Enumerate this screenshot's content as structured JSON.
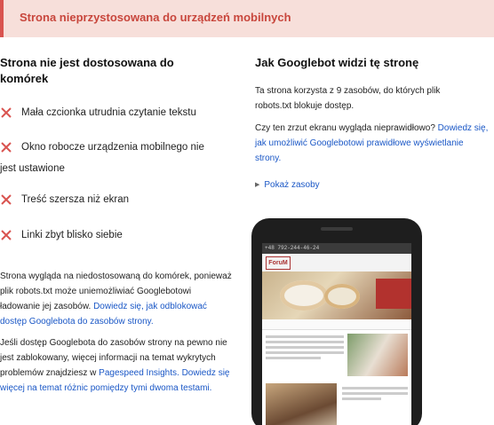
{
  "banner": {
    "title": "Strona nieprzystosowana do urządzeń mobilnych"
  },
  "left": {
    "heading": "Strona nie jest dostosowana do komórek",
    "issues": [
      {
        "icon": "x-icon",
        "label": "Mała czcionka utrudnia czytanie tekstu"
      },
      {
        "icon": "x-icon",
        "label": "Okno robocze urządzenia mobilnego nie",
        "continuation": "jest ustawione"
      },
      {
        "icon": "x-icon",
        "label": "Treść szersza niż ekran"
      },
      {
        "icon": "x-icon",
        "label": "Linki zbyt blisko siebie"
      }
    ],
    "para1": {
      "text": "Strona wygląda na niedostosowaną do komórek, ponieważ plik robots.txt może uniemożliwiać Googlebotowi ładowanie jej zasobów.",
      "link": "Dowiedz się, jak odblokować dostęp Googlebota do zasobów strony."
    },
    "para2": {
      "text": "Jeśli dostęp Googlebota do zasobów strony na pewno nie jest zablokowany, więcej informacji na temat wykrytych problemów znajdziesz w",
      "link1": "Pagespeed Insights.",
      "link2": "Dowiedz się więcej na temat różnic pomiędzy tymi dwoma testami."
    }
  },
  "right": {
    "heading": "Jak Googlebot widzi tę stronę",
    "p1": "Ta strona korzysta z 9 zasobów, do których plik robots.txt blokuje dostęp.",
    "p2_text": "Czy ten zrzut ekranu wygląda nieprawidłowo?",
    "p2_link": "Dowiedz się, jak umożliwić Googlebotowi prawidłowe wyświetlanie strony.",
    "show_resources": "Pokaż zasoby",
    "screenshot": {
      "phone_number": "+48 792-244-46-24",
      "logo": "ForuM"
    }
  },
  "colors": {
    "banner_bg": "#f7dfda",
    "banner_text": "#c8463c",
    "link": "#1a57c6",
    "issue_x": "#d9534f"
  }
}
